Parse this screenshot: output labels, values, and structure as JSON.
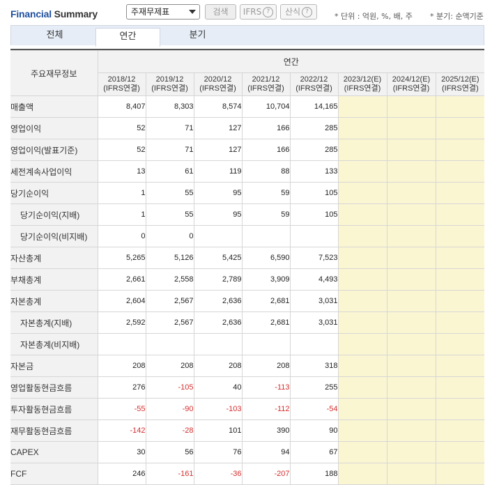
{
  "header": {
    "brand_part1": "Financial",
    "brand_part2": "Summary",
    "select_value": "주재무제표",
    "search_label": "검색",
    "ifrs_label": "IFRS",
    "calc_label": "산식",
    "help_glyph": "?",
    "unit_note": "* 단위 : 억원, %, 배, 주",
    "period_note": "* 분기: 순액기준"
  },
  "tabs": [
    {
      "label": "전체",
      "active": false
    },
    {
      "label": "연간",
      "active": true
    },
    {
      "label": "분기",
      "active": false
    }
  ],
  "table": {
    "corner_label": "주요재무정보",
    "group_label": "연간",
    "columns": [
      {
        "period": "2018/12",
        "basis": "(IFRS연결)",
        "estimate": false
      },
      {
        "period": "2019/12",
        "basis": "(IFRS연결)",
        "estimate": false
      },
      {
        "period": "2020/12",
        "basis": "(IFRS연결)",
        "estimate": false
      },
      {
        "period": "2021/12",
        "basis": "(IFRS연결)",
        "estimate": false
      },
      {
        "period": "2022/12",
        "basis": "(IFRS연결)",
        "estimate": false
      },
      {
        "period": "2023/12(E)",
        "basis": "(IFRS연결)",
        "estimate": true
      },
      {
        "period": "2024/12(E)",
        "basis": "(IFRS연결)",
        "estimate": true
      },
      {
        "period": "2025/12(E)",
        "basis": "(IFRS연결)",
        "estimate": true
      }
    ],
    "rows": [
      {
        "label": "매출액",
        "indent": false,
        "values": [
          "8,407",
          "8,303",
          "8,574",
          "10,704",
          "14,165",
          "",
          "",
          ""
        ]
      },
      {
        "label": "영업이익",
        "indent": false,
        "values": [
          "52",
          "71",
          "127",
          "166",
          "285",
          "",
          "",
          ""
        ]
      },
      {
        "label": "영업이익(발표기준)",
        "indent": false,
        "values": [
          "52",
          "71",
          "127",
          "166",
          "285",
          "",
          "",
          ""
        ]
      },
      {
        "label": "세전계속사업이익",
        "indent": false,
        "values": [
          "13",
          "61",
          "119",
          "88",
          "133",
          "",
          "",
          ""
        ]
      },
      {
        "label": "당기순이익",
        "indent": false,
        "values": [
          "1",
          "55",
          "95",
          "59",
          "105",
          "",
          "",
          ""
        ]
      },
      {
        "label": "당기순이익(지배)",
        "indent": true,
        "values": [
          "1",
          "55",
          "95",
          "59",
          "105",
          "",
          "",
          ""
        ]
      },
      {
        "label": "당기순이익(비지배)",
        "indent": true,
        "values": [
          "0",
          "0",
          "",
          "",
          "",
          "",
          "",
          ""
        ]
      },
      {
        "label": "자산총계",
        "indent": false,
        "values": [
          "5,265",
          "5,126",
          "5,425",
          "6,590",
          "7,523",
          "",
          "",
          ""
        ]
      },
      {
        "label": "부채총계",
        "indent": false,
        "values": [
          "2,661",
          "2,558",
          "2,789",
          "3,909",
          "4,493",
          "",
          "",
          ""
        ]
      },
      {
        "label": "자본총계",
        "indent": false,
        "values": [
          "2,604",
          "2,567",
          "2,636",
          "2,681",
          "3,031",
          "",
          "",
          ""
        ]
      },
      {
        "label": "자본총계(지배)",
        "indent": true,
        "values": [
          "2,592",
          "2,567",
          "2,636",
          "2,681",
          "3,031",
          "",
          "",
          ""
        ]
      },
      {
        "label": "자본총계(비지배)",
        "indent": true,
        "values": [
          "",
          "",
          "",
          "",
          "",
          "",
          "",
          ""
        ]
      },
      {
        "label": "자본금",
        "indent": false,
        "values": [
          "208",
          "208",
          "208",
          "208",
          "318",
          "",
          "",
          ""
        ]
      },
      {
        "label": "영업활동현금흐름",
        "indent": false,
        "values": [
          "276",
          "-105",
          "40",
          "-113",
          "255",
          "",
          "",
          ""
        ]
      },
      {
        "label": "투자활동현금흐름",
        "indent": false,
        "values": [
          "-55",
          "-90",
          "-103",
          "-112",
          "-54",
          "",
          "",
          ""
        ]
      },
      {
        "label": "재무활동현금흐름",
        "indent": false,
        "values": [
          "-142",
          "-28",
          "101",
          "390",
          "90",
          "",
          "",
          ""
        ]
      },
      {
        "label": "CAPEX",
        "indent": false,
        "values": [
          "30",
          "56",
          "76",
          "94",
          "67",
          "",
          "",
          ""
        ]
      },
      {
        "label": "FCF",
        "indent": false,
        "values": [
          "246",
          "-161",
          "-36",
          "-207",
          "188",
          "",
          "",
          ""
        ]
      }
    ]
  },
  "colors": {
    "brand_blue": "#1f4f9e",
    "negative": "#d32f2f",
    "estimate_bg": "#fbf6d2",
    "header_bg": "#f2f2f2",
    "tab_bg": "#e6edf6"
  }
}
